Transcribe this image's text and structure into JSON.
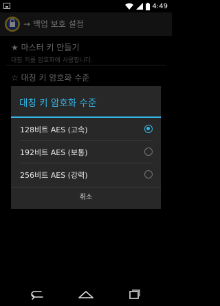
{
  "status_bar": {
    "time": "4:49",
    "icons": [
      "image-icon",
      "wifi-icon",
      "signal-icon",
      "battery-icon"
    ]
  },
  "action_bar": {
    "title": "→ 백업 보호 설정",
    "logo": "app-logo-icon"
  },
  "settings": [
    {
      "title": "★ 마스터 키 만들기",
      "summary": "대칭 키를 암호화에 사용합니다."
    },
    {
      "title": "☆ 대칭 키 암호화 수준",
      "summary": ""
    }
  ],
  "dialog": {
    "title": "대칭 키 암호화 수준",
    "options": [
      {
        "label": "128비트 AES (고속)",
        "selected": true
      },
      {
        "label": "192비트 AES (보통)",
        "selected": false
      },
      {
        "label": "256비트 AES (강력)",
        "selected": false
      }
    ],
    "cancel_label": "취소"
  },
  "colors": {
    "accent": "#33b5e5",
    "dialog_bg": "#282828",
    "action_bar_bg": "#222222"
  },
  "nav_bar": {
    "buttons": [
      "back-icon",
      "home-icon",
      "recents-icon"
    ]
  }
}
